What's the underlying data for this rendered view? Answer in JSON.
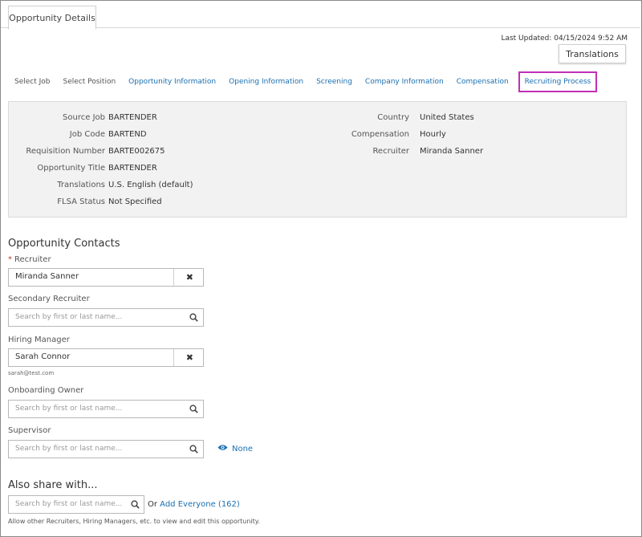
{
  "tabs": {
    "active": "Opportunity Details"
  },
  "last_updated": "Last Updated: 04/15/2024 9:52 AM",
  "translations_button": "Translations",
  "steps": [
    {
      "label": "Select Job",
      "state": "gray"
    },
    {
      "label": "Select Position",
      "state": "gray"
    },
    {
      "label": "Opportunity Information",
      "state": "link"
    },
    {
      "label": "Opening Information",
      "state": "link"
    },
    {
      "label": "Screening",
      "state": "link"
    },
    {
      "label": "Company Information",
      "state": "link"
    },
    {
      "label": "Compensation",
      "state": "link"
    },
    {
      "label": "Recruiting Process",
      "state": "active"
    }
  ],
  "summary": {
    "left": [
      {
        "label": "Source Job",
        "value": "BARTENDER"
      },
      {
        "label": "Job Code",
        "value": "BARTEND"
      },
      {
        "label": "Requisition Number",
        "value": "BARTE002675"
      },
      {
        "label": "Opportunity Title",
        "value": "BARTENDER"
      },
      {
        "label": "Translations",
        "value": "U.S. English (default)"
      },
      {
        "label": "FLSA Status",
        "value": "Not Specified"
      }
    ],
    "right": [
      {
        "label": "Country",
        "value": "United States"
      },
      {
        "label": "Compensation",
        "value": "Hourly"
      },
      {
        "label": "Recruiter",
        "value": "Miranda Sanner"
      }
    ]
  },
  "contacts": {
    "title": "Opportunity Contacts",
    "required_mark": "*",
    "recruiter": {
      "label": "Recruiter",
      "value": "Miranda Sanner"
    },
    "secondary_recruiter": {
      "label": "Secondary Recruiter",
      "placeholder": "Search by first or last name..."
    },
    "hiring_manager": {
      "label": "Hiring Manager",
      "value": "Sarah Connor",
      "email": "sarah@test.com"
    },
    "onboarding_owner": {
      "label": "Onboarding Owner",
      "placeholder": "Search by first or last name..."
    },
    "supervisor": {
      "label": "Supervisor",
      "placeholder": "Search by first or last name..."
    },
    "visibility_link": "None",
    "clear_symbol": "✖"
  },
  "share": {
    "title": "Also share with...",
    "placeholder": "Search by first or last name...",
    "or_text": "Or",
    "add_everyone": "Add Everyone (162)",
    "note": "Allow other Recruiters, Hiring Managers, etc. to view and edit this opportunity."
  },
  "colors": {
    "link": "#1a6fb0",
    "active_outline": "#c22fb5",
    "summary_bg": "#f2f2f2"
  }
}
